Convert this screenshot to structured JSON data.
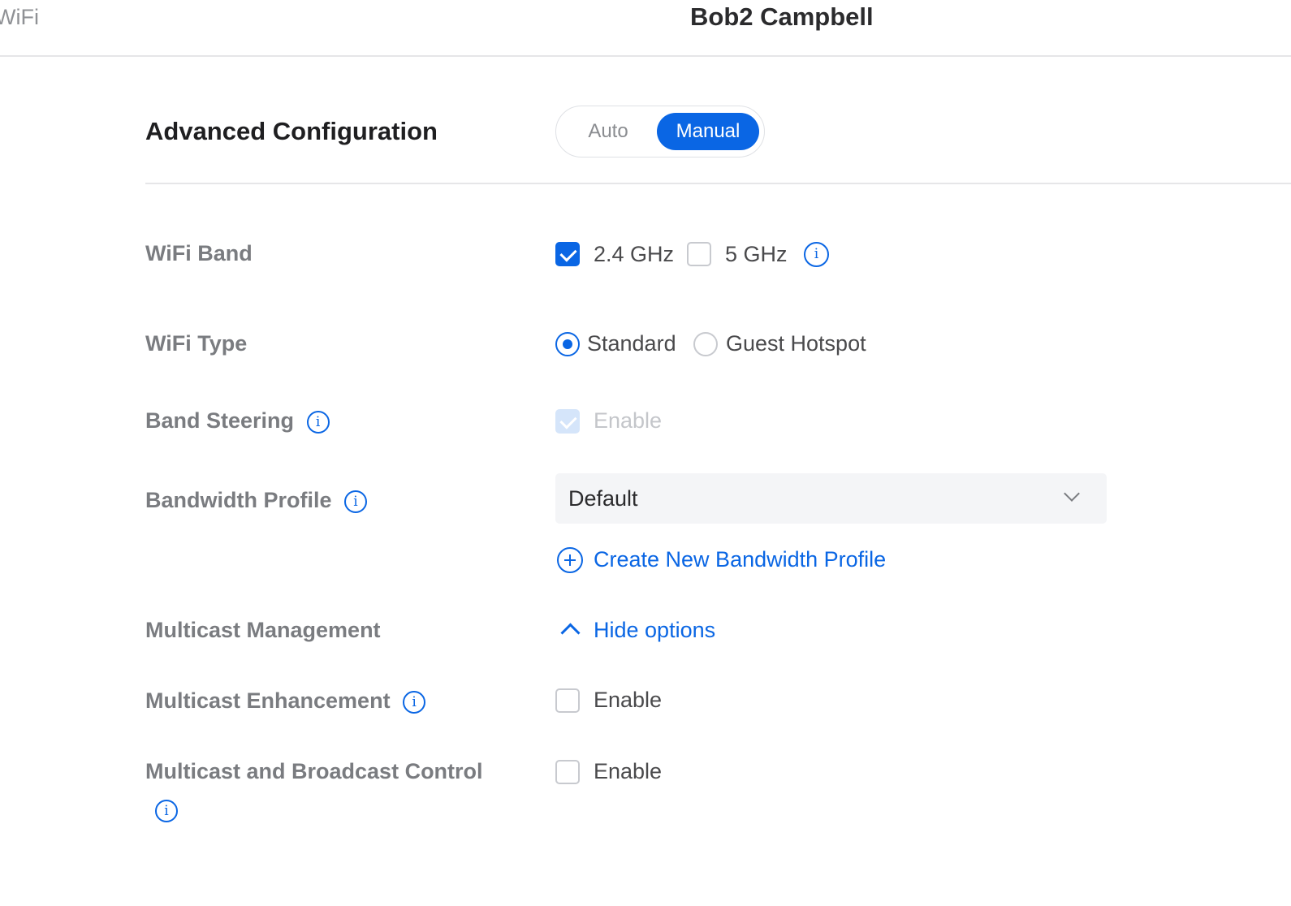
{
  "header": {
    "back_label": "WiFi",
    "device_name": "Bob2 Campbell"
  },
  "section": {
    "title": "Advanced Configuration",
    "mode_options": [
      "Auto",
      "Manual"
    ],
    "selected_mode": "Manual"
  },
  "wifi_band": {
    "label": "WiFi Band",
    "options": [
      {
        "label": "2.4 GHz",
        "checked": true
      },
      {
        "label": "5 GHz",
        "checked": false
      }
    ]
  },
  "wifi_type": {
    "label": "WiFi Type",
    "options": [
      {
        "label": "Standard",
        "selected": true
      },
      {
        "label": "Guest Hotspot",
        "selected": false
      }
    ]
  },
  "band_steering": {
    "label": "Band Steering",
    "option_label": "Enable",
    "checked": true,
    "disabled": true
  },
  "bandwidth_profile": {
    "label": "Bandwidth Profile",
    "selected": "Default",
    "create_link": "Create New Bandwidth Profile"
  },
  "multicast_management": {
    "label": "Multicast Management",
    "toggle_label": "Hide options"
  },
  "multicast_enhancement": {
    "label": "Multicast Enhancement",
    "option_label": "Enable",
    "checked": false
  },
  "multicast_broadcast_control": {
    "label": "Multicast and Broadcast Control",
    "option_label": "Enable",
    "checked": false
  },
  "colors": {
    "accent": "#0a66e4",
    "label": "#7a7c80",
    "divider": "#e6e6e8"
  },
  "icons": [
    "info-icon",
    "plus-circle-icon",
    "chevron-down-icon",
    "chevron-up-icon",
    "checkmark-icon"
  ]
}
